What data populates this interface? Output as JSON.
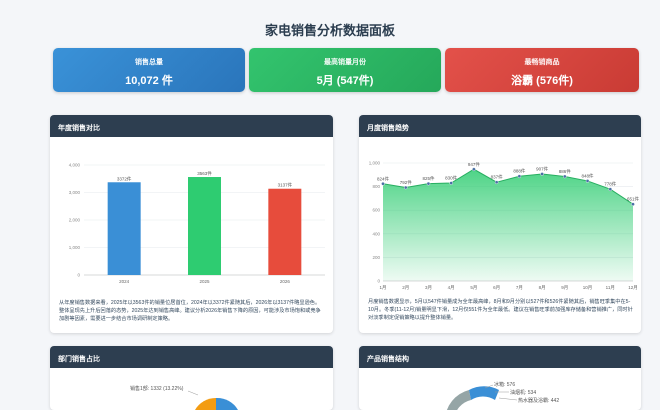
{
  "page_title": "家电销售分析数据面板",
  "kpis": [
    {
      "label": "销售总量",
      "value": "10,072 件"
    },
    {
      "label": "最高销量月份",
      "value": "5月 (547件)"
    },
    {
      "label": "最畅销商品",
      "value": "浴霸 (576件)"
    }
  ],
  "panels": {
    "yearly_title": "年度销售对比",
    "monthly_title": "月度销售趋势",
    "dept_title": "部门销售占比",
    "product_title": "产品销售结构"
  },
  "yearly_desc": "从年度销售数据来看，2025年以3563件的销量位居首位，2024年以3372件紧随其后，2026年以3137件略显逊色。整体呈现先上升后回落的态势，2025年达到销售高峰。建议分析2026年销售下降的原因，可能涉及市场饱和或竞争加剧等因素，需要进一步结合市场调研制定策略。",
  "monthly_desc": "月度销售数据显示，5月以547件销量成为全年最高峰，8月和9月分别以527件和526件紧随其后，销售旺季集中在5-10月。冬季(11-12月)销量明显下滑，12月仅551件为全年最低。建议在销售旺季前加强库存储备和营销推广，同时针对淡季制定促销策略以提升整体销量。",
  "chart_data": [
    {
      "type": "bar",
      "title": "年度销售对比",
      "categories": [
        "2024",
        "2025",
        "2026"
      ],
      "values": [
        3372,
        3563,
        3137
      ],
      "value_labels": [
        "3372件",
        "3563件",
        "3137件"
      ],
      "ylim": [
        0,
        4000
      ],
      "yticks": [
        "0",
        "1,000",
        "2,000",
        "3,000",
        "4,000"
      ],
      "colors": [
        "#3a8fd6",
        "#2ecc71",
        "#e74c3c"
      ],
      "grid": true
    },
    {
      "type": "area",
      "title": "月度销售趋势",
      "categories": [
        "1月",
        "2月",
        "3月",
        "4月",
        "5月",
        "6月",
        "7月",
        "8月",
        "9月",
        "10月",
        "11月",
        "12月"
      ],
      "values": [
        824,
        792,
        825,
        830,
        947,
        837,
        888,
        907,
        886,
        848,
        778,
        651
      ],
      "value_labels": [
        "824件",
        "792件",
        "825件",
        "830件",
        "947件",
        "837件",
        "888件",
        "907件",
        "886件",
        "848件",
        "778件",
        "651件"
      ],
      "ylim": [
        0,
        1000
      ],
      "yticks": [
        "0",
        "200",
        "400",
        "600",
        "800",
        "1,000"
      ],
      "color": "#2ecc71",
      "grid": true
    }
  ],
  "dept_partial": {
    "label": "销售1部: 1332 (13.22%)",
    "colors": [
      "#3a8fd6",
      "#f39c12"
    ]
  },
  "product_partial": {
    "labels": [
      "冰箱: 576",
      "油烟机: 534",
      "热水器及浴霸: 442"
    ],
    "colors": [
      "#3a8fd6",
      "#2ecc71",
      "#95a5a6"
    ]
  }
}
